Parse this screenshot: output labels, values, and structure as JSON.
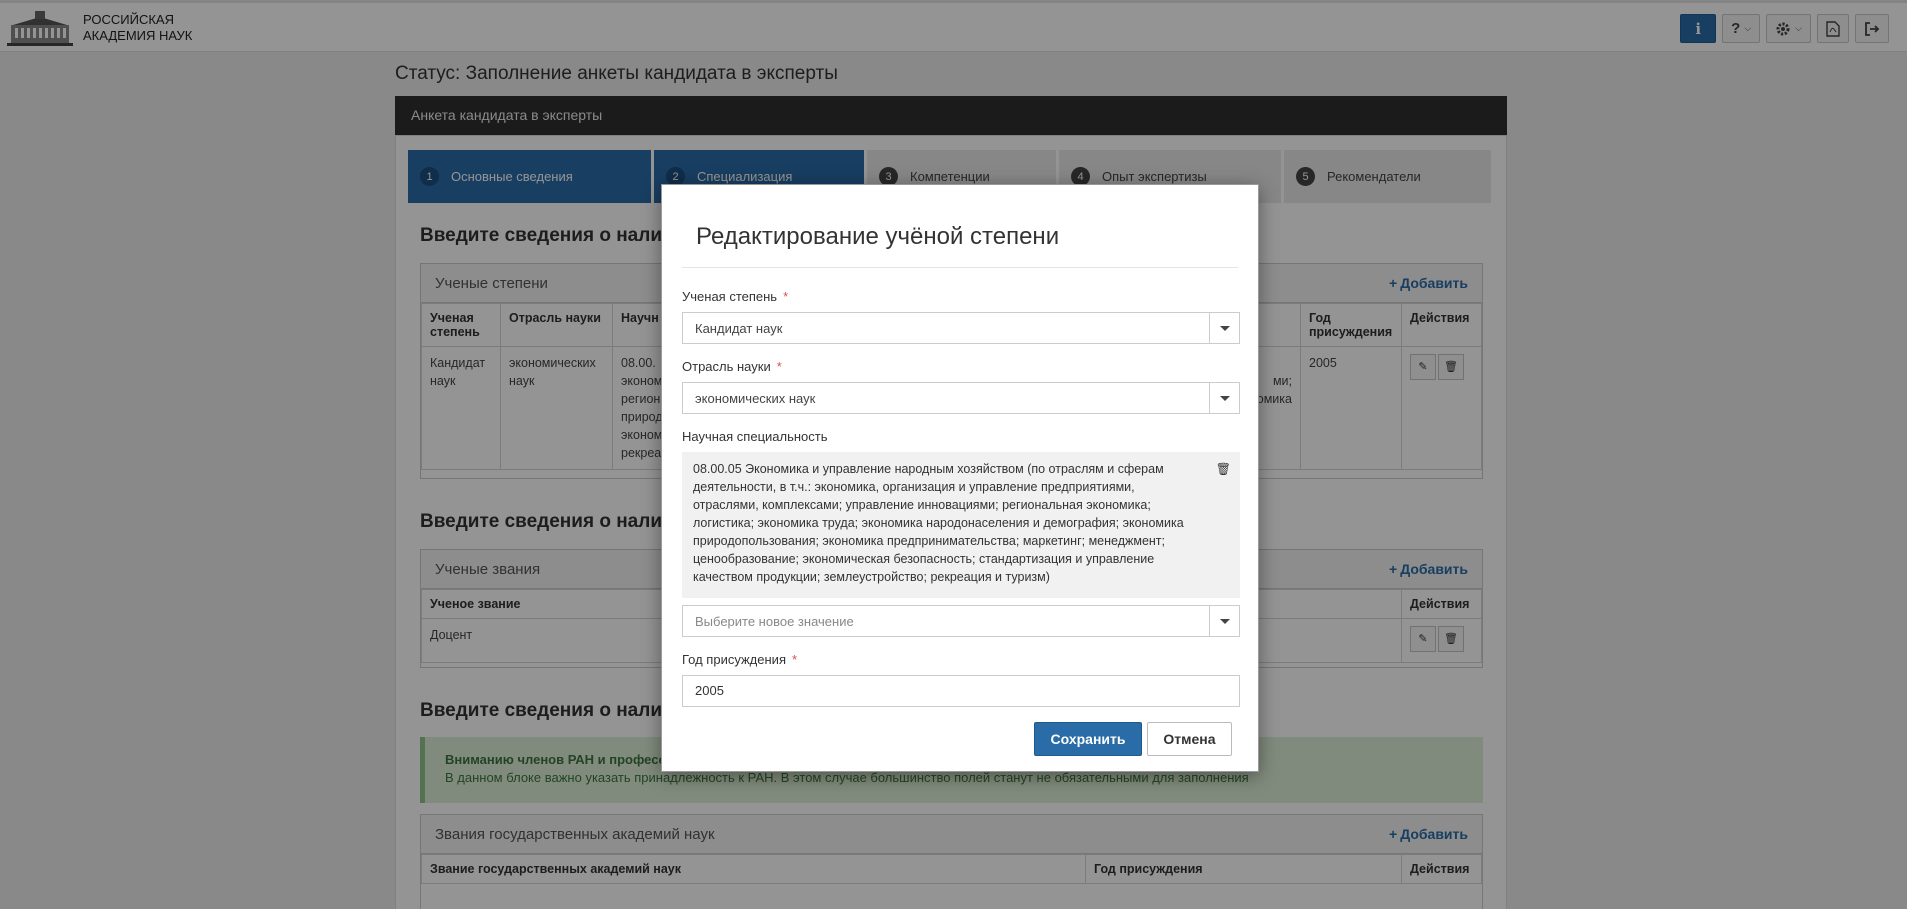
{
  "header": {
    "org_name_line1": "РОССИЙСКАЯ",
    "org_name_line2": "АКАДЕМИЯ НАУК",
    "icons": [
      "info-icon",
      "help-icon",
      "gear-icon",
      "pdf-icon",
      "logout-icon"
    ],
    "info_label": "i",
    "help_label": "?",
    "accent_color": "#2a6ca8"
  },
  "page": {
    "status_title": "Статус: Заполнение анкеты кандидата в эксперты",
    "panel_title": "Анкета кандидата в эксперты"
  },
  "wizard": {
    "steps": [
      {
        "num": "1",
        "label": "Основные сведения"
      },
      {
        "num": "2",
        "label": "Специализация"
      },
      {
        "num": "3",
        "label": "Компетенции"
      },
      {
        "num": "4",
        "label": "Опыт экспертизы"
      },
      {
        "num": "5",
        "label": "Рекомендатели"
      }
    ]
  },
  "section1": {
    "title": "Введите сведения о налич",
    "block_title": "Ученые степени",
    "add_label": "Добавить",
    "columns": {
      "degree": "Ученая степень",
      "field": "Отрасль науки",
      "spec": "Научн",
      "year": "Год присуждения",
      "actions": "Действия"
    },
    "row": {
      "degree": "Кандидат наук",
      "field": "экономических наук",
      "spec_lines": [
        "08.00.",
        "эконом",
        "регион",
        "природ",
        "эконом",
        "рекреа"
      ],
      "right_fragment_1": "ми;",
      "right_fragment_2": "омика",
      "year": "2005"
    }
  },
  "section2": {
    "title": "Введите сведения о налич",
    "block_title": "Ученые звания",
    "add_label": "Добавить",
    "col_title": "Ученое звание",
    "col_actions": "Действия",
    "row_title": "Доцент"
  },
  "section3": {
    "title": "Введите сведения о налич",
    "alert_title": "Вниманию членов РАН и професс",
    "alert_text": "В данном блоке важно указать принадлежность к РАН. В этом случае большинство полей станут не обязательными для заполнения",
    "block_title": "Звания государственных академий наук",
    "add_label": "Добавить",
    "col_title": "Звание государственных академий наук",
    "col_year": "Год присуждения",
    "col_actions": "Действия"
  },
  "modal": {
    "title": "Редактирование учёной степени",
    "degree_label": "Ученая степень",
    "degree_value": "Кандидат наук",
    "field_label": "Отрасль науки",
    "field_value": "экономических наук",
    "spec_label": "Научная специальность",
    "spec_text": "08.00.05 Экономика и управление народным хозяйством (по отраслям и сферам деятельности, в т.ч.: экономика, организация и управление предприятиями, отраслями, комплексами; управление инновациями; региональная экономика; логистика; экономика труда; экономика народонаселения и демография; экономика природопользования; экономика предпринимательства; маркетинг; менеджмент; ценообразование; экономическая безопасность; стандартизация и управление качеством продукции; землеустройство; рекреация и туризм)",
    "spec_placeholder": "Выберите новое значение",
    "year_label": "Год присуждения",
    "year_value": "2005",
    "required_mark": "*",
    "save_label": "Сохранить",
    "cancel_label": "Отмена"
  }
}
